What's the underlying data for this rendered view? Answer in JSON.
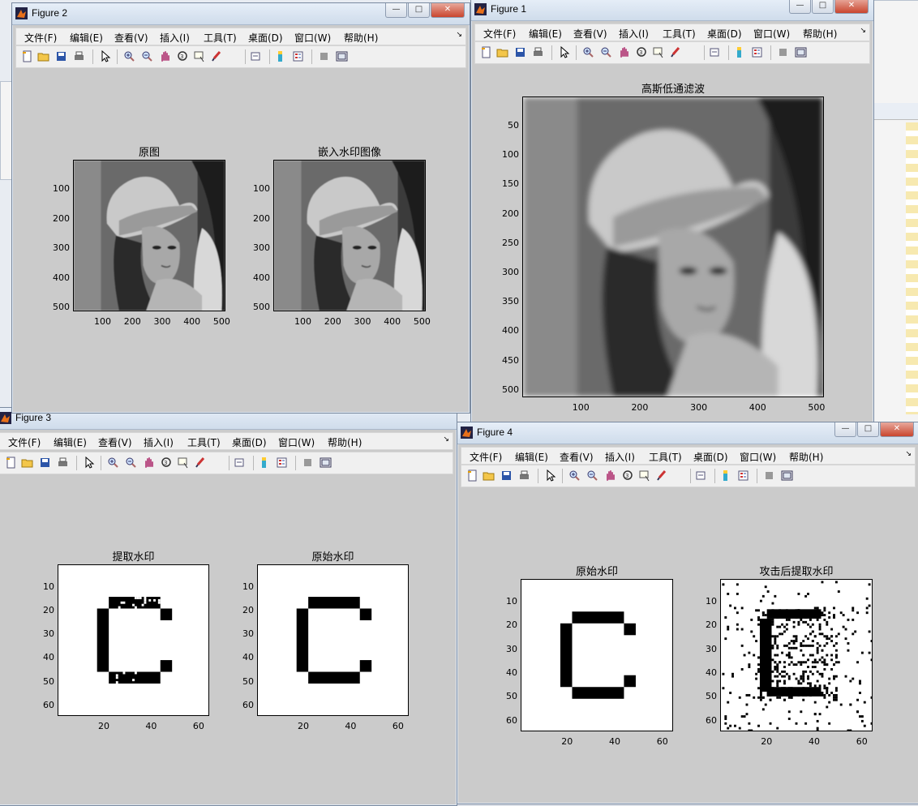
{
  "menu": [
    "文件(F)",
    "编辑(E)",
    "查看(V)",
    "插入(I)",
    "工具(T)",
    "桌面(D)",
    "窗口(W)",
    "帮助(H)"
  ],
  "figures": {
    "fig2": {
      "title": "Figure 2",
      "axes": [
        {
          "title": "原图",
          "yticks": [
            "100",
            "200",
            "300",
            "400",
            "500"
          ],
          "xticks": [
            "100",
            "200",
            "300",
            "400",
            "500"
          ]
        },
        {
          "title": "嵌入水印图像",
          "yticks": [
            "100",
            "200",
            "300",
            "400",
            "500"
          ],
          "xticks": [
            "100",
            "200",
            "300",
            "400",
            "500"
          ]
        }
      ]
    },
    "fig1": {
      "title": "Figure 1",
      "axes": [
        {
          "title": "高斯低通滤波",
          "yticks": [
            "50",
            "100",
            "150",
            "200",
            "250",
            "300",
            "350",
            "400",
            "450",
            "500"
          ],
          "xticks": [
            "100",
            "200",
            "300",
            "400",
            "500"
          ]
        }
      ]
    },
    "fig3": {
      "title": "Figure 3",
      "axes": [
        {
          "title": "提取水印",
          "yticks": [
            "10",
            "20",
            "30",
            "40",
            "50",
            "60"
          ],
          "xticks": [
            "20",
            "40",
            "60"
          ]
        },
        {
          "title": "原始水印",
          "yticks": [
            "10",
            "20",
            "30",
            "40",
            "50",
            "60"
          ],
          "xticks": [
            "20",
            "40",
            "60"
          ]
        }
      ]
    },
    "fig4": {
      "title": "Figure 4",
      "axes": [
        {
          "title": "原始水印",
          "yticks": [
            "10",
            "20",
            "30",
            "40",
            "50",
            "60"
          ],
          "xticks": [
            "20",
            "40",
            "60"
          ]
        },
        {
          "title": "攻击后提取水印",
          "yticks": [
            "10",
            "20",
            "30",
            "40",
            "50",
            "60"
          ],
          "xticks": [
            "20",
            "40",
            "60"
          ]
        }
      ]
    }
  },
  "icons": [
    "new-file-icon",
    "open-folder-icon",
    "save-icon",
    "print-icon",
    "pointer-icon",
    "zoom-in-icon",
    "zoom-out-icon",
    "pan-icon",
    "rotate-3d-icon",
    "data-cursor-icon",
    "brush-icon",
    "link-icon",
    "colorbar-icon",
    "legend-icon",
    "hide-plot-tools-icon",
    "show-plot-tools-icon"
  ],
  "colors": {
    "figure_bg": "#cbcbcb",
    "titlebar": "#d6e2f0",
    "close": "#c9452e"
  }
}
